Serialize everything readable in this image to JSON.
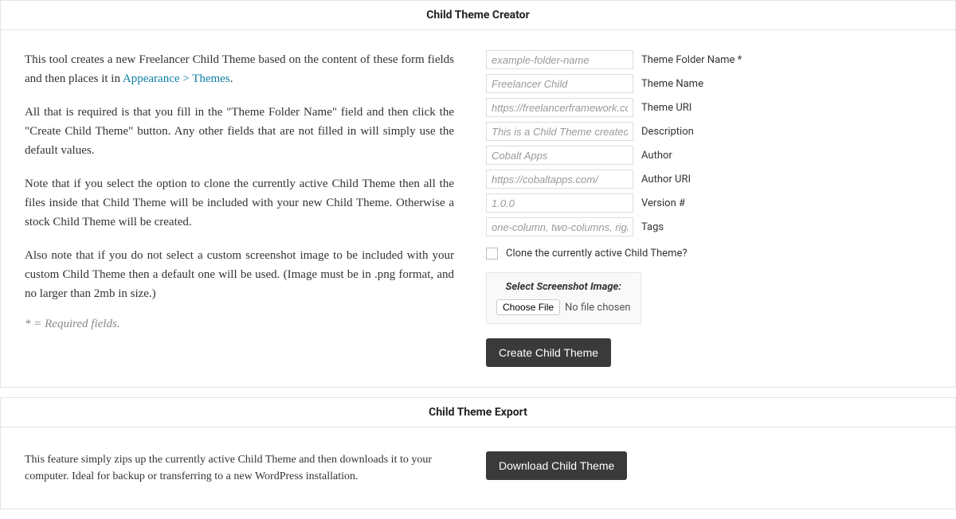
{
  "creator": {
    "title": "Child Theme Creator",
    "intro_prefix": "This tool creates a new Freelancer Child Theme based on the content of these form fields and then places it in ",
    "intro_link": "Appearance > Themes",
    "intro_suffix": ".",
    "para2": "All that is required is that you fill in the \"Theme Folder Name\" field and then click the \"Create Child Theme\" button. Any other fields that are not filled in will simply use the default values.",
    "para3": "Note that if you select the option to clone the currently active Child Theme then all the files inside that Child Theme will be included with your new Child Theme. Otherwise a stock Child Theme will be created.",
    "para4": "Also note that if you do not select a custom screenshot image to be included with your custom Child Theme then a default one will be used. (Image must be in .png format, and no larger than 2mb in size.)",
    "required_note": "* = Required fields.",
    "fields": {
      "folder_name": {
        "placeholder": "example-folder-name",
        "label": "Theme Folder Name *"
      },
      "theme_name": {
        "placeholder": "Freelancer Child",
        "label": "Theme Name"
      },
      "theme_uri": {
        "placeholder": "https://freelancerframework.com/",
        "label": "Theme URI"
      },
      "description": {
        "placeholder": "This is a Child Theme created for",
        "label": "Description"
      },
      "author": {
        "placeholder": "Cobalt Apps",
        "label": "Author"
      },
      "author_uri": {
        "placeholder": "https://cobaltapps.com/",
        "label": "Author URI"
      },
      "version": {
        "placeholder": "1.0.0",
        "label": "Version #"
      },
      "tags": {
        "placeholder": "one-column, two-columns, right-s",
        "label": "Tags"
      }
    },
    "clone_label": "Clone the currently active Child Theme?",
    "screenshot_title": "Select Screenshot Image:",
    "choose_file": "Choose File",
    "no_file": "No file chosen",
    "create_button": "Create Child Theme"
  },
  "export": {
    "title": "Child Theme Export",
    "description": "This feature simply zips up the currently active Child Theme and then downloads it to your computer. Ideal for backup or transferring to a new WordPress installation.",
    "download_button": "Download Child Theme"
  }
}
